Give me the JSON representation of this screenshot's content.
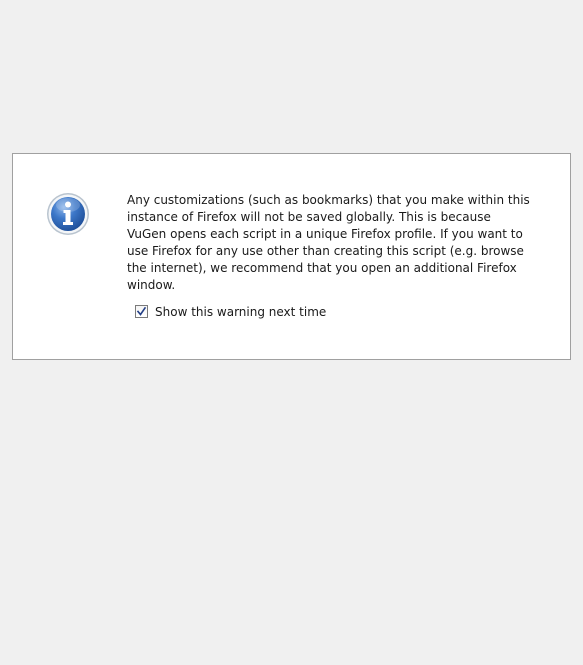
{
  "dialog": {
    "icon": "info-icon",
    "message": "Any customizations (such as bookmarks) that you make within this instance of Firefox will not be saved globally. This is because VuGen opens each script in a unique Firefox profile. If you want to use Firefox for any use other than creating this script (e.g. browse the internet), we recommend that you open an additional Firefox window.",
    "show_warning": {
      "label": "Show this warning next time",
      "checked": true
    }
  },
  "colors": {
    "background": "#f0f0f0",
    "panel": "#ffffff",
    "panel_border": "#a0a0a0",
    "icon_blue": "#2f63ae",
    "checkmark": "#233f86"
  }
}
